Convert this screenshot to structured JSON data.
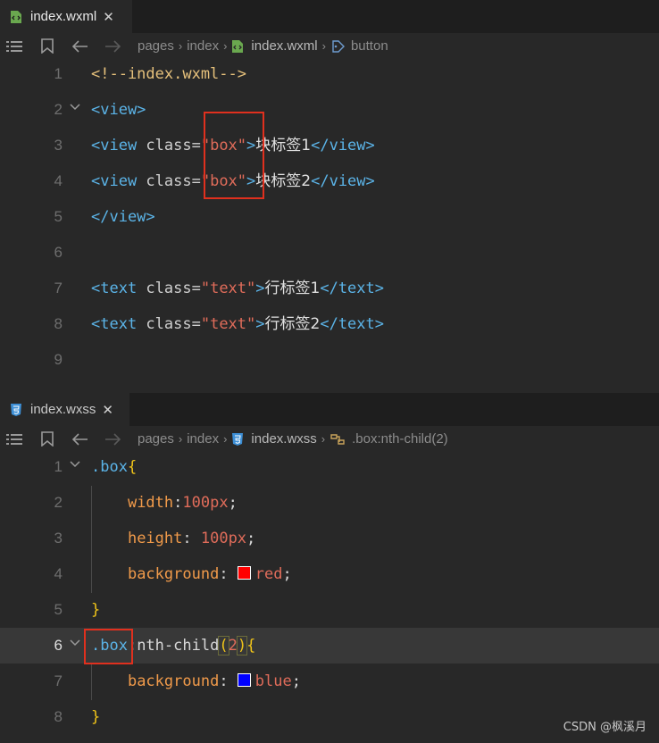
{
  "top_editor": {
    "tab": {
      "filename": "index.wxml",
      "close": "✕"
    },
    "breadcrumbs": [
      "pages",
      "index",
      "index.wxml",
      "button"
    ],
    "lines": [
      {
        "num": "1",
        "tokens": [
          [
            "c-com",
            "<!--index.wxml-->"
          ]
        ]
      },
      {
        "num": "2",
        "tokens": [
          [
            "c-tag",
            "<view>"
          ]
        ]
      },
      {
        "num": "3",
        "tokens": [
          [
            "c-tag",
            "<view "
          ],
          [
            "c-attr",
            "class="
          ],
          [
            "c-str",
            "\"box\""
          ],
          [
            "c-tag",
            ">"
          ],
          [
            "c-txt",
            "块标签1"
          ],
          [
            "c-tag",
            "</view>"
          ]
        ]
      },
      {
        "num": "4",
        "tokens": [
          [
            "c-tag",
            "<view "
          ],
          [
            "c-attr",
            "class="
          ],
          [
            "c-str",
            "\"box\""
          ],
          [
            "c-tag",
            ">"
          ],
          [
            "c-txt",
            "块标签2"
          ],
          [
            "c-tag",
            "</view>"
          ]
        ]
      },
      {
        "num": "5",
        "tokens": [
          [
            "c-tag",
            "</view>"
          ]
        ]
      },
      {
        "num": "6",
        "tokens": []
      },
      {
        "num": "7",
        "tokens": [
          [
            "c-tag",
            "<text "
          ],
          [
            "c-attr",
            "class="
          ],
          [
            "c-str",
            "\"text\""
          ],
          [
            "c-tag",
            ">"
          ],
          [
            "c-txt",
            "行标签1"
          ],
          [
            "c-tag",
            "</text>"
          ]
        ]
      },
      {
        "num": "8",
        "tokens": [
          [
            "c-tag",
            "<text "
          ],
          [
            "c-attr",
            "class="
          ],
          [
            "c-str",
            "\"text\""
          ],
          [
            "c-tag",
            ">"
          ],
          [
            "c-txt",
            "行标签2"
          ],
          [
            "c-tag",
            "</text>"
          ]
        ]
      },
      {
        "num": "9",
        "tokens": []
      }
    ]
  },
  "bottom_editor": {
    "tab": {
      "filename": "index.wxss",
      "close": "✕"
    },
    "breadcrumbs": [
      "pages",
      "index",
      "index.wxss",
      ".box:nth-child(2)"
    ],
    "lines": [
      {
        "num": "1",
        "tokens": [
          [
            "c-sel",
            ".box"
          ],
          [
            "c-brace",
            "{"
          ]
        ]
      },
      {
        "num": "2",
        "tokens": [
          [
            "c-plain",
            "    "
          ],
          [
            "c-prop",
            "width"
          ],
          [
            "c-plain",
            ":"
          ],
          [
            "c-num",
            "100px"
          ],
          [
            "c-plain",
            ";"
          ]
        ]
      },
      {
        "num": "3",
        "tokens": [
          [
            "c-plain",
            "    "
          ],
          [
            "c-prop",
            "height"
          ],
          [
            "c-plain",
            ": "
          ],
          [
            "c-num",
            "100px"
          ],
          [
            "c-plain",
            ";"
          ]
        ]
      },
      {
        "num": "4",
        "tokens": [
          [
            "c-plain",
            "    "
          ],
          [
            "c-prop",
            "background"
          ],
          [
            "c-plain",
            ": "
          ],
          [
            "swatch-red",
            ""
          ],
          [
            "c-num",
            "red"
          ],
          [
            "c-plain",
            ";"
          ]
        ]
      },
      {
        "num": "5",
        "tokens": [
          [
            "c-brace",
            "}"
          ]
        ]
      },
      {
        "num": "6",
        "tokens": [
          [
            "c-sel",
            ".box"
          ],
          [
            "c-plain",
            ":nth-child"
          ],
          [
            "c-brace-hl",
            "("
          ],
          [
            "c-num",
            "2"
          ],
          [
            "c-brace-hl",
            ")"
          ],
          [
            "c-brace",
            "{"
          ]
        ]
      },
      {
        "num": "7",
        "tokens": [
          [
            "c-plain",
            "    "
          ],
          [
            "c-prop",
            "background"
          ],
          [
            "c-plain",
            ": "
          ],
          [
            "swatch-blue",
            ""
          ],
          [
            "c-num",
            "blue"
          ],
          [
            "c-plain",
            ";"
          ]
        ]
      },
      {
        "num": "8",
        "tokens": [
          [
            "c-brace",
            "}"
          ]
        ]
      }
    ],
    "current_line": "6"
  },
  "colors": {
    "red": "#ff0000",
    "blue": "#0000ff",
    "highlight_box": "#e0301e"
  },
  "watermark": "CSDN @枫溪月"
}
